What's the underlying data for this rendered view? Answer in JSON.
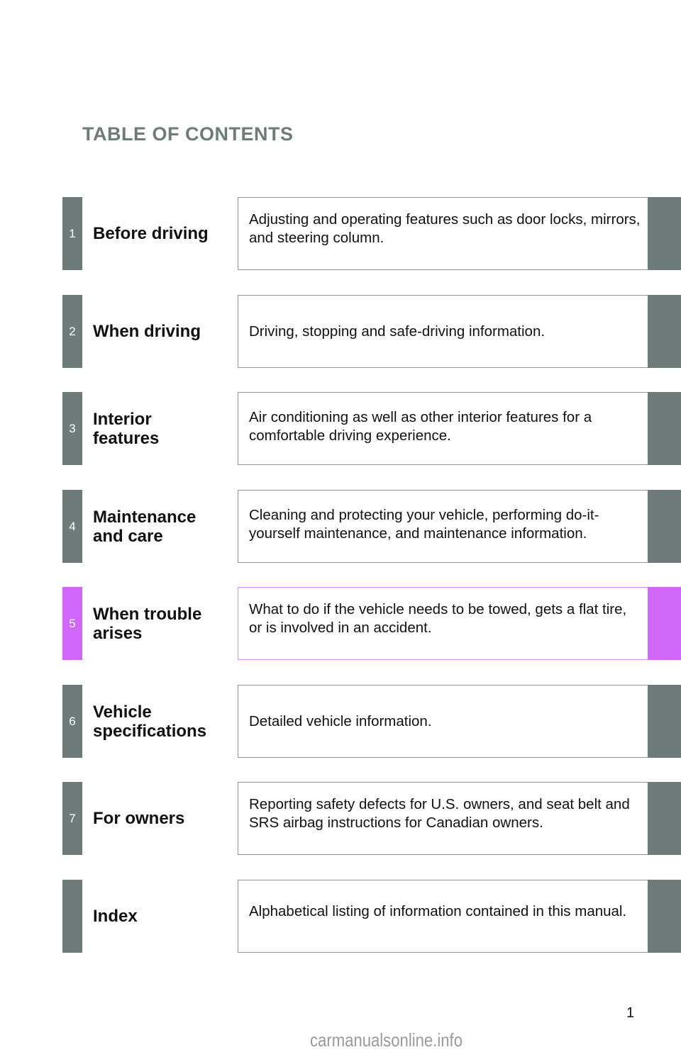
{
  "page_title": "TABLE OF CONTENTS",
  "colors": {
    "default_tab": "#6d7c7a",
    "highlight_tab": "#d166fa"
  },
  "sections": [
    {
      "number": "1",
      "title": "Before driving",
      "description": "Adjusting and operating features such as door locks, mirrors, and steering column.",
      "highlighted": false
    },
    {
      "number": "2",
      "title": "When driving",
      "description": "Driving, stopping and safe-driving information.",
      "highlighted": false
    },
    {
      "number": "3",
      "title": "Interior features",
      "description": "Air conditioning as well as other interior features for a comfortable driving experience.",
      "highlighted": false
    },
    {
      "number": "4",
      "title": "Maintenance and care",
      "description": "Cleaning and protecting your vehicle, performing do-it-yourself maintenance, and maintenance information.",
      "highlighted": false
    },
    {
      "number": "5",
      "title": "When trouble arises",
      "description": "What to do if the vehicle needs to be towed, gets a flat tire, or is involved in an accident.",
      "highlighted": true
    },
    {
      "number": "6",
      "title": "Vehicle specifications",
      "description": "Detailed vehicle information.",
      "highlighted": false
    },
    {
      "number": "7",
      "title": "For owners",
      "description": "Reporting safety defects for U.S. owners, and seat belt and SRS airbag instructions for Canadian owners.",
      "highlighted": false
    },
    {
      "number": "",
      "title": "Index",
      "description": "Alphabetical listing of information contained in this manual.",
      "highlighted": false
    }
  ],
  "page_number": "1",
  "watermark": "carmanualsonline.info"
}
